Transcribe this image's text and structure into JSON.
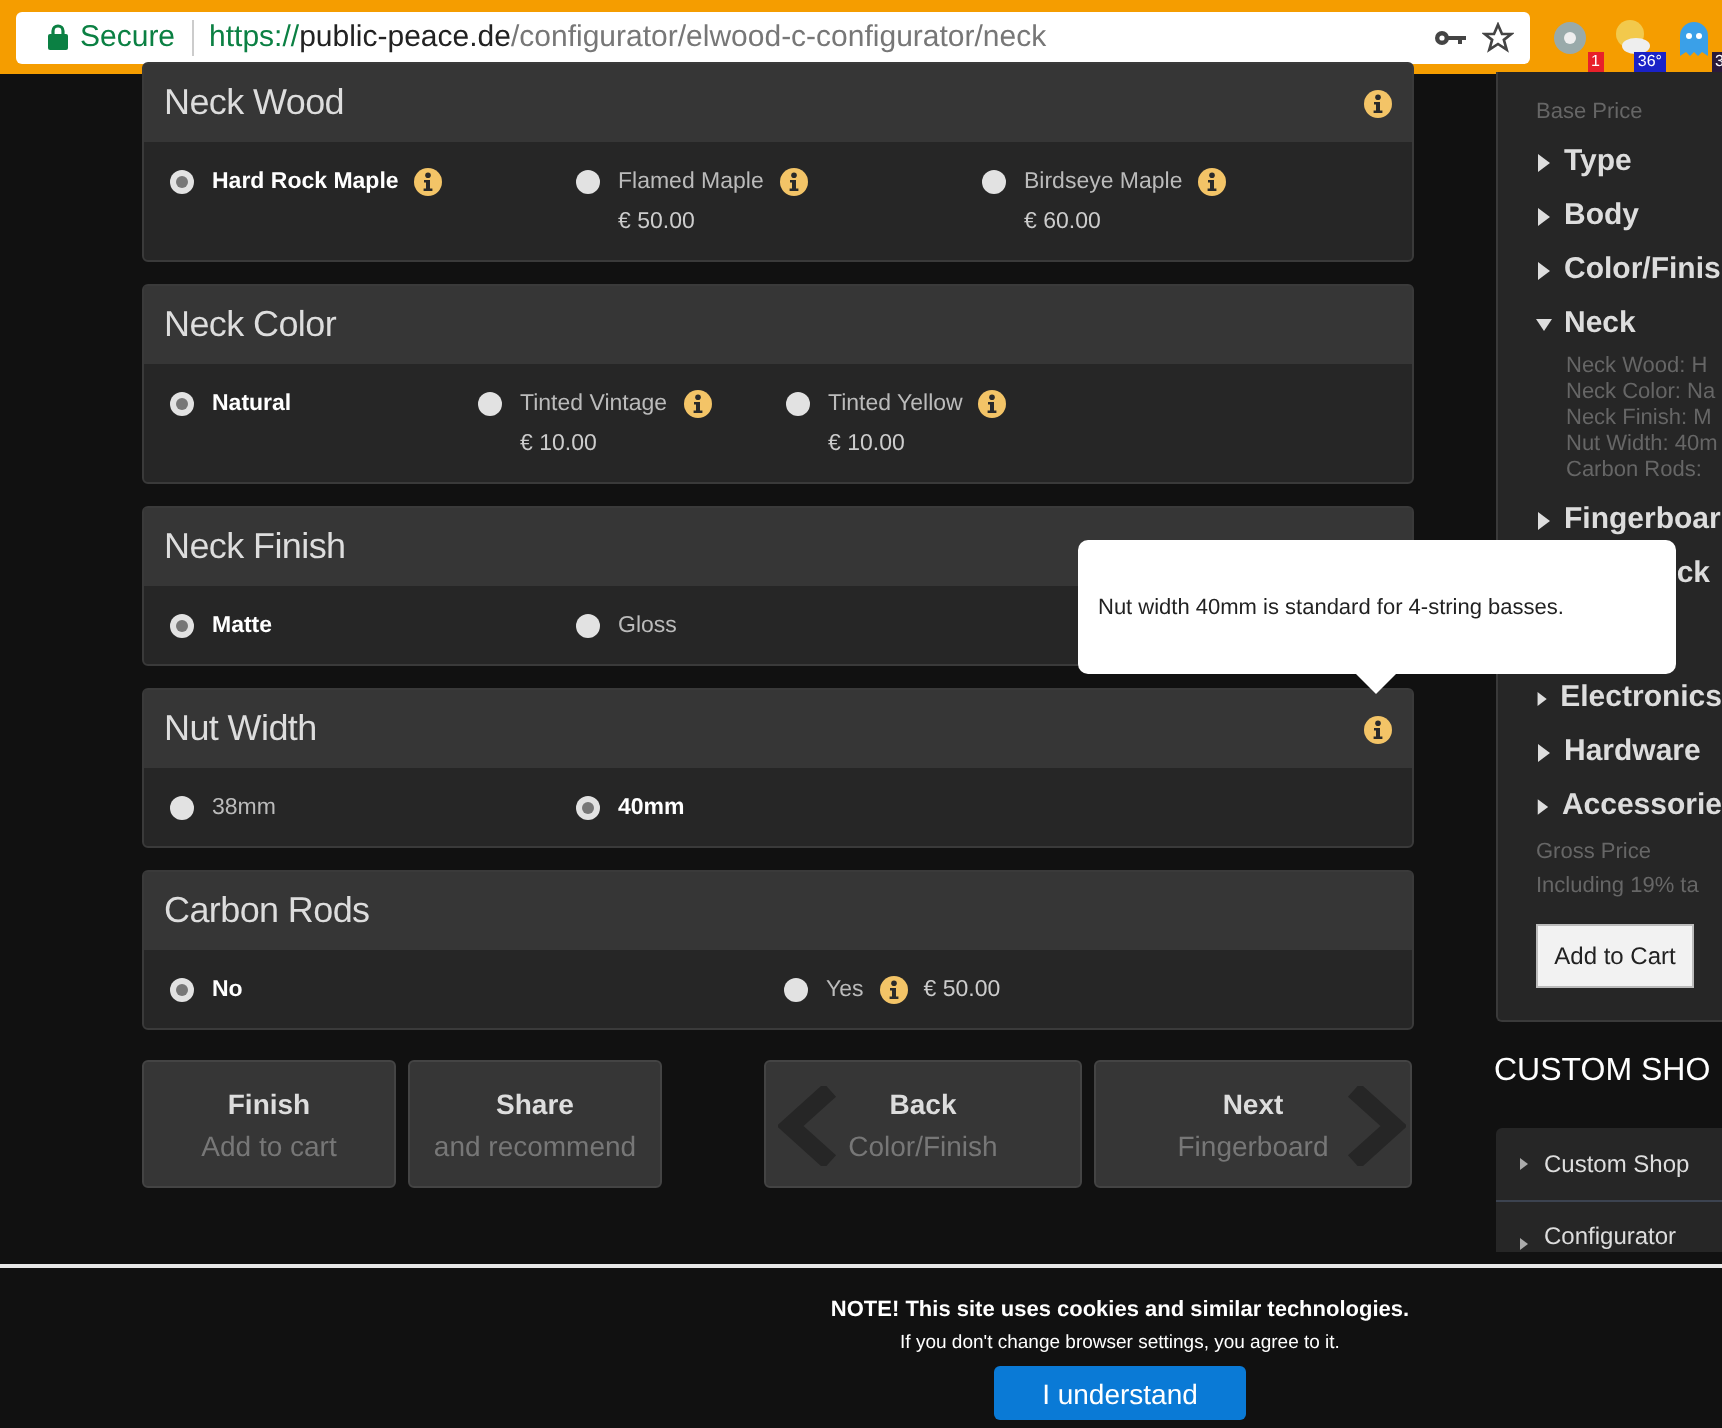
{
  "browser": {
    "security_label": "Secure",
    "url_scheme": "https://",
    "url_host": "public-peace.de",
    "url_path": "/configurator/elwood-c-configurator/neck",
    "extensions": [
      {
        "kind": "round",
        "badge": "1",
        "color": "#e8202a"
      },
      {
        "kind": "weather",
        "badge": "36°",
        "color": "#1a22c8"
      },
      {
        "kind": "ghost",
        "badge": "3",
        "color": "#2a1a3a"
      }
    ]
  },
  "sections": [
    {
      "title": "Neck Wood",
      "info": true,
      "kind": "stacked",
      "options": [
        {
          "label": "Hard Rock Maple",
          "selected": true,
          "info": true
        },
        {
          "label": "Flamed Maple",
          "selected": false,
          "info": true,
          "price": "€ 50.00"
        },
        {
          "label": "Birdseye Maple",
          "selected": false,
          "info": true,
          "price": "€ 60.00"
        }
      ]
    },
    {
      "title": "Neck Color",
      "info": false,
      "kind": "stacked",
      "options": [
        {
          "label": "Natural",
          "selected": true,
          "info": false
        },
        {
          "label": "Tinted Vintage",
          "selected": false,
          "info": true,
          "price": "€ 10.00"
        },
        {
          "label": "Tinted Yellow",
          "selected": false,
          "info": true,
          "price": "€ 10.00"
        }
      ]
    },
    {
      "title": "Neck Finish",
      "info": false,
      "kind": "stacked",
      "options": [
        {
          "label": "Matte",
          "selected": true,
          "info": false
        },
        {
          "label": "Gloss",
          "selected": false,
          "info": false
        }
      ]
    },
    {
      "title": "Nut Width",
      "info": true,
      "kind": "stacked",
      "options": [
        {
          "label": "38mm",
          "selected": false,
          "info": false
        },
        {
          "label": "40mm",
          "selected": true,
          "info": false
        }
      ]
    },
    {
      "title": "Carbon Rods",
      "info": false,
      "kind": "inline",
      "options": [
        {
          "label": "No",
          "selected": true,
          "info": false
        },
        {
          "label": "Yes",
          "selected": false,
          "info": true,
          "price": "€ 50.00"
        }
      ]
    }
  ],
  "nav_buttons": [
    {
      "kind": "plain",
      "title": "Finish",
      "subtitle": "Add to cart"
    },
    {
      "kind": "plain",
      "title": "Share",
      "subtitle": "and recommend"
    },
    {
      "kind": "back",
      "title": "Back",
      "subtitle": "Color/Finish"
    },
    {
      "kind": "next",
      "title": "Next",
      "subtitle": "Fingerboard"
    }
  ],
  "tooltip": {
    "text": "Nut width 40mm is standard for 4-string basses."
  },
  "summary": {
    "base_price_label": "Base Price",
    "items": [
      {
        "label": "Type",
        "expanded": false
      },
      {
        "label": "Body",
        "expanded": false
      },
      {
        "label": "Color/Finis",
        "expanded": false
      },
      {
        "label": "Neck",
        "expanded": true,
        "details": [
          "Neck Wood: H",
          "Neck Color: Na",
          "Neck Finish: M",
          "Nut Width: 40m",
          "Carbon Rods:"
        ]
      },
      {
        "label": "Fingerboar",
        "expanded": false
      },
      {
        "label": "ck",
        "expanded": false,
        "kind": "covered"
      },
      {
        "label": "Electronics",
        "expanded": false
      },
      {
        "label": "Hardware",
        "expanded": false
      },
      {
        "label": "Accessorie",
        "expanded": false
      }
    ],
    "gross_price_label": "Gross Price",
    "tax_note": "Including 19% ta",
    "add_to_cart": "Add to Cart"
  },
  "custom_shop": {
    "title": "CUSTOM SHO",
    "menu": [
      "Custom Shop",
      "Configurator"
    ]
  },
  "cookie_notice": {
    "title": "NOTE! This site uses cookies and similar technologies.",
    "text": "If you don't change browser settings, you agree to it.",
    "button": "I understand"
  }
}
